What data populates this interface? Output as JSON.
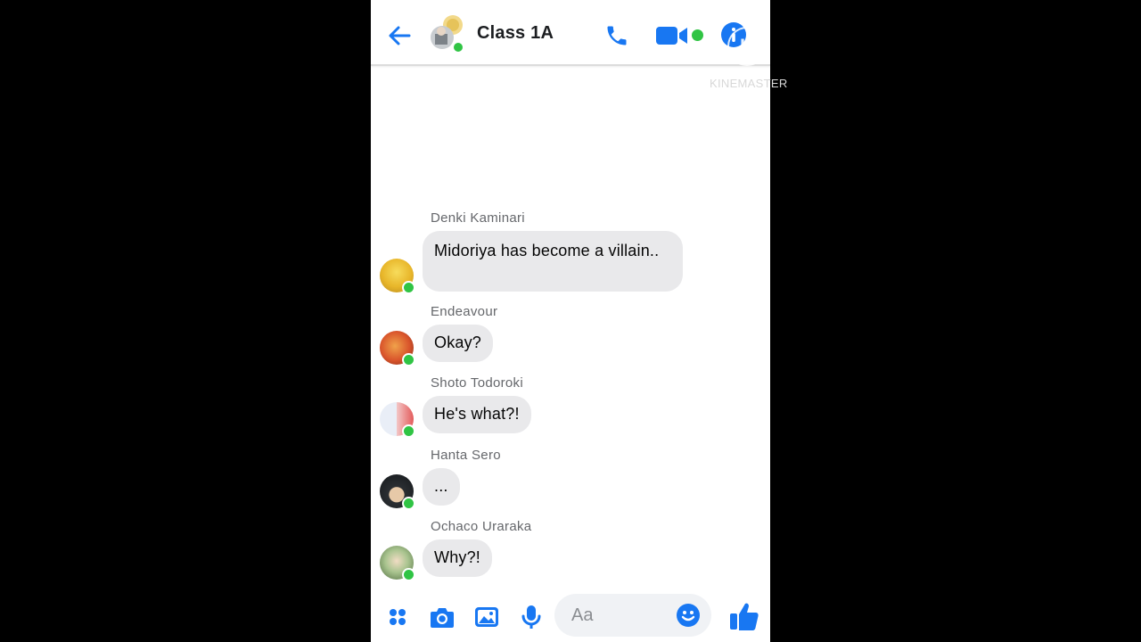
{
  "header": {
    "title": "Class 1A",
    "back_icon": "arrow-left-icon",
    "call_icon": "phone-icon",
    "video_icon": "video-camera-icon",
    "info_icon": "info-icon"
  },
  "watermark": {
    "letter": "K",
    "text": "KINEMASTER"
  },
  "messages": [
    {
      "sender": "Denki Kaminari",
      "text": "Midoriya has become a villain..",
      "avatar_color": "#e8c23a"
    },
    {
      "sender": "Endeavour",
      "text": "Okay?",
      "avatar_color": "#d9542b"
    },
    {
      "sender": "Shoto Todoroki",
      "text": "He's what?!",
      "avatar_color": "#c9d3e8"
    },
    {
      "sender": "Hanta Sero",
      "text": "...",
      "avatar_color": "#2b2f33"
    },
    {
      "sender": "Ochaco Uraraka",
      "text": "Why?!",
      "avatar_color": "#7aa06a"
    }
  ],
  "composer": {
    "placeholder": "Aa",
    "icons": [
      "apps-icon",
      "camera-icon",
      "image-icon",
      "microphone-icon",
      "emoji-icon",
      "thumbs-up-icon"
    ]
  },
  "colors": {
    "accent": "#1877f2",
    "online": "#30c444",
    "bubble": "#e9e9eb"
  }
}
